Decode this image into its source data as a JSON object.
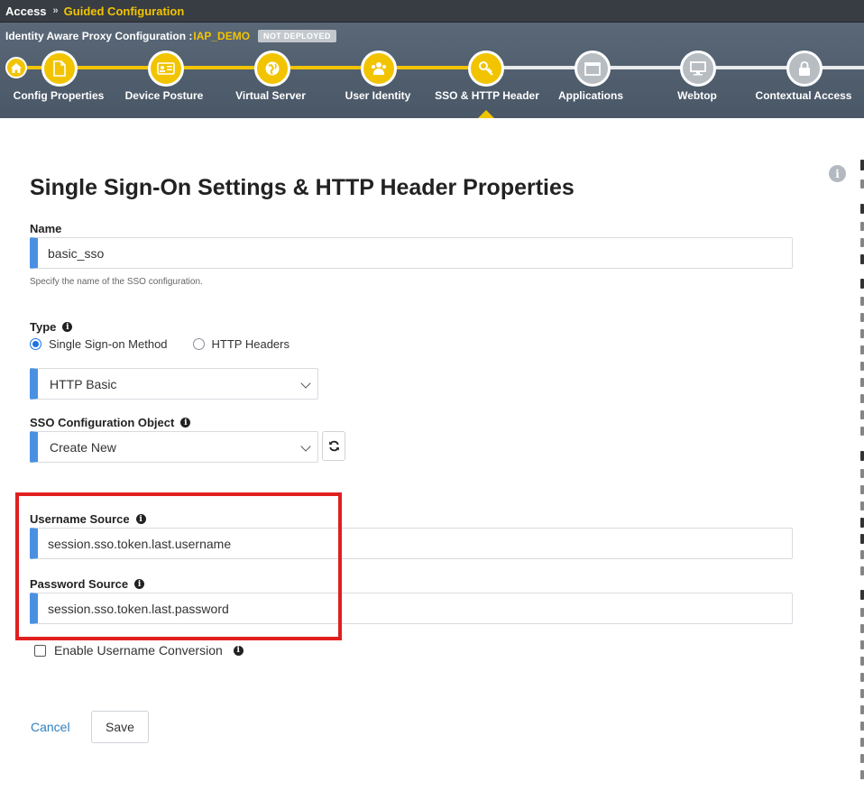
{
  "breadcrumb": {
    "root": "Access",
    "separator": "»",
    "current": "Guided Configuration"
  },
  "wizard": {
    "title_prefix": "Identity Aware Proxy Configuration :",
    "config_name": "IAP_DEMO",
    "status": "NOT DEPLOYED",
    "steps": [
      {
        "label": "Config Properties",
        "icon": "document-icon",
        "state": "done"
      },
      {
        "label": "Device Posture",
        "icon": "id-card-icon",
        "state": "done"
      },
      {
        "label": "Virtual Server",
        "icon": "globe-icon",
        "state": "done"
      },
      {
        "label": "User Identity",
        "icon": "users-icon",
        "state": "done"
      },
      {
        "label": "SSO & HTTP Header",
        "icon": "key-icon",
        "state": "active"
      },
      {
        "label": "Applications",
        "icon": "window-icon",
        "state": "todo"
      },
      {
        "label": "Webtop",
        "icon": "monitor-icon",
        "state": "todo"
      },
      {
        "label": "Contextual Access",
        "icon": "lock-icon",
        "state": "todo"
      }
    ]
  },
  "page": {
    "title": "Single Sign-On Settings & HTTP Header Properties"
  },
  "form": {
    "name_label": "Name",
    "name_value": "basic_sso",
    "name_help": "Specify the name of the SSO configuration.",
    "type_label": "Type",
    "type_options": [
      "Single Sign-on Method",
      "HTTP Headers"
    ],
    "type_selected": "Single Sign-on Method",
    "method_value": "HTTP Basic",
    "sso_object_label": "SSO Configuration Object",
    "sso_object_value": "Create New",
    "username_source_label": "Username Source",
    "username_source_value": "session.sso.token.last.username",
    "password_source_label": "Password Source",
    "password_source_value": "session.sso.token.last.password",
    "username_conversion_label": "Enable Username Conversion",
    "username_conversion_checked": false
  },
  "actions": {
    "cancel": "Cancel",
    "save": "Save"
  },
  "colors": {
    "accent_yellow": "#f2c400",
    "field_accent_blue": "#4a90e2",
    "highlight_red": "#e0201f",
    "header_bg": "#4f5d6d"
  }
}
